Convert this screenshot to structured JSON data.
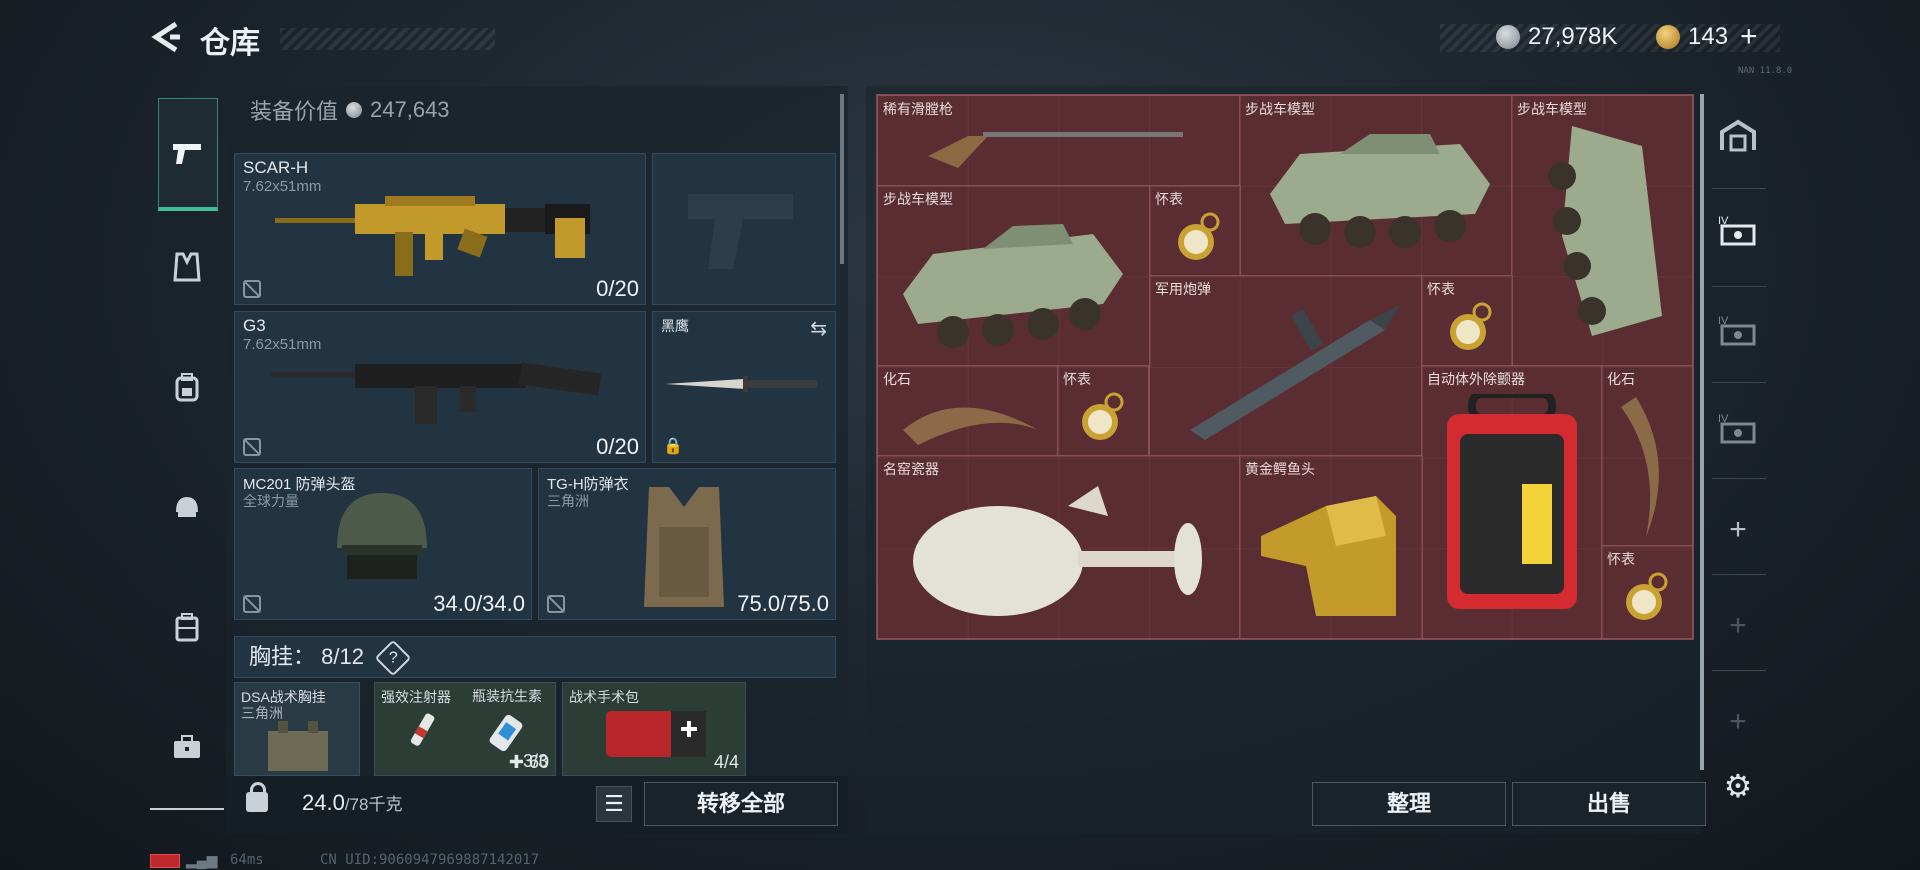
{
  "header": {
    "title": "仓库",
    "silver_amount": "27,978K",
    "gold_amount": "143",
    "tag_text": "NAN 11.8.0"
  },
  "rail": {
    "items": [
      "pistol-icon",
      "vest-icon",
      "backpack-icon",
      "helmet-icon",
      "case-icon",
      "toolbox-icon"
    ]
  },
  "equipment": {
    "value_label": "装备价值",
    "value": "247,643",
    "weapon1": {
      "name": "SCAR-H",
      "caliber": "7.62x51mm",
      "ammo": "0/20"
    },
    "weapon2": {
      "name": "G3",
      "caliber": "7.62x51mm",
      "ammo": "0/20"
    },
    "melee": {
      "name": "黑鹰"
    },
    "helmet": {
      "name": "MC201 防弹头盔",
      "brand": "全球力量",
      "durability": "34.0/34.0"
    },
    "armor": {
      "name": "TG-H防弹衣",
      "brand": "三角洲",
      "durability": "75.0/75.0"
    },
    "chest": {
      "label": "胸挂：",
      "capacity": "8/12",
      "help": "?"
    },
    "rig": {
      "name": "DSA战术胸挂",
      "brand": "三角洲"
    },
    "slots": [
      {
        "name": "强效注射器",
        "count": "60"
      },
      {
        "name": "瓶装抗生素",
        "count": "3/3"
      },
      {
        "name": "战术手术包",
        "count": "4/4"
      }
    ],
    "weight": "24.0",
    "weight_limit": "/78千克",
    "transfer_all": "转移全部"
  },
  "storage": {
    "items": [
      {
        "name": "稀有滑膛枪"
      },
      {
        "name": "步战车模型"
      },
      {
        "name": "步战车模型"
      },
      {
        "name": "步战车模型"
      },
      {
        "name": "怀表"
      },
      {
        "name": "军用炮弹"
      },
      {
        "name": "怀表"
      },
      {
        "name": "化石"
      },
      {
        "name": "怀表"
      },
      {
        "name": "自动体外除颤器"
      },
      {
        "name": "化石"
      },
      {
        "name": "名窑瓷器"
      },
      {
        "name": "黄金鳄鱼头"
      },
      {
        "name": "怀表"
      }
    ],
    "sort_label": "整理",
    "sell_label": "出售"
  },
  "status": {
    "ping": "64ms",
    "uid": "CN UID:9060947969887142017"
  },
  "colors": {
    "accent": "#3fbf95",
    "grid_bg": "#532a30",
    "panel": "#223342"
  }
}
